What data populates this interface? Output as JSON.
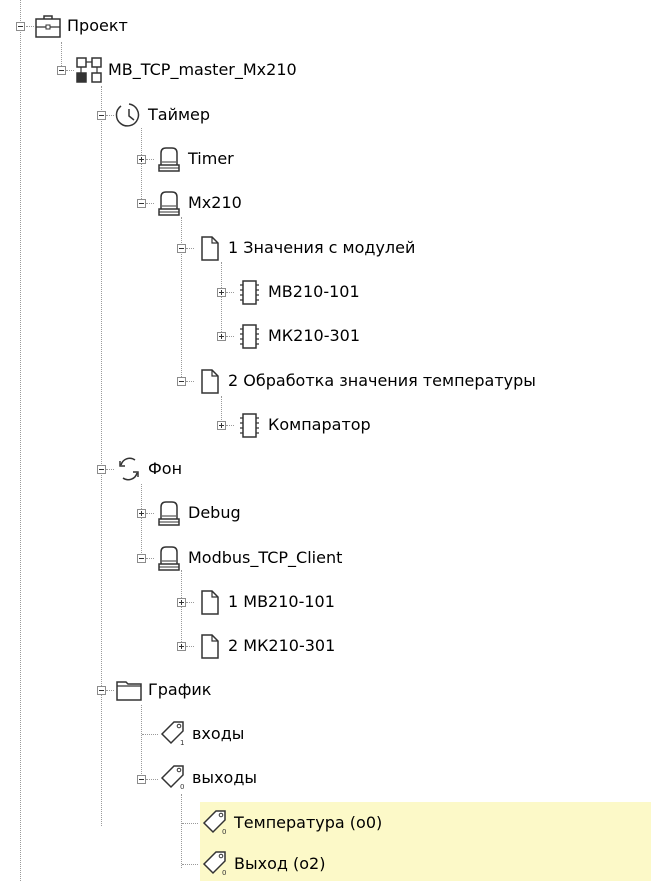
{
  "tree": {
    "project": "Проект",
    "app": "MB_TCP_master_Mx210",
    "timer_task": "Таймер",
    "timer": "Timer",
    "mx210": "Mx210",
    "page_values": "1 Значения с модулей",
    "mv210": "МВ210-101",
    "mk210": "МК210-301",
    "page_temp": "2 Обработка значения температуры",
    "comparator": "Компаратор",
    "background_task": "Фон",
    "debug": "Debug",
    "modbus_client": "Modbus_TCP_Client",
    "client_mv": "1 МВ210-101",
    "client_mk": "2 МК210-301",
    "graph": "График",
    "inputs": "входы",
    "outputs": "выходы",
    "temperature": "Температура  (o0)",
    "output": "Выход  (o2)"
  },
  "icons": {
    "project": "briefcase-icon",
    "app": "app-blocks-icon",
    "timer_task": "clock-icon",
    "background_task": "cycle-icon",
    "program": "stack-icon",
    "page": "page-icon",
    "block": "chip-icon",
    "graph": "folder-icon",
    "tag": "tag-icon"
  },
  "colors": {
    "selection_highlight": "#fcf9c8",
    "tree_line": "#9a9a9a"
  }
}
